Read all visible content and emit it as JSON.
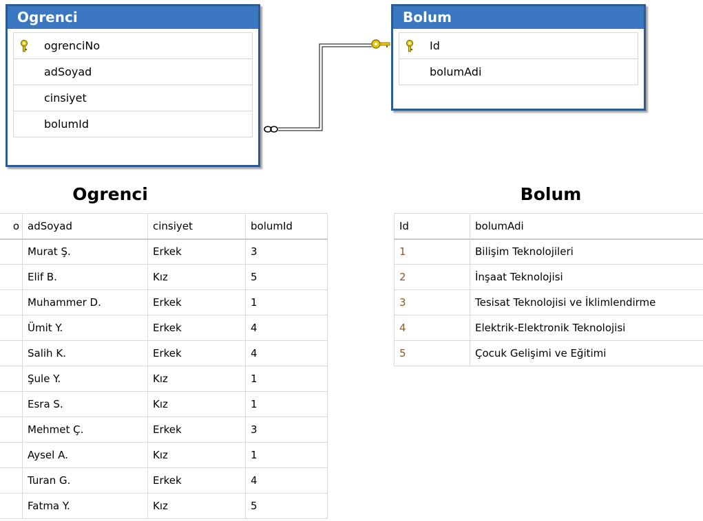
{
  "entities": {
    "ogrenci": {
      "name": "Ogrenci",
      "fields": [
        "ogrenciNo",
        "adSoyad",
        "cinsiyet",
        "bolumId"
      ],
      "key_field": "ogrenciNo"
    },
    "bolum": {
      "name": "Bolum",
      "fields": [
        "Id",
        "bolumAdi"
      ],
      "key_field": "Id"
    }
  },
  "relationship": {
    "from": "Bolum.Id",
    "to": "Ogrenci.bolumId",
    "type": "one-to-many",
    "one_end_icon": "key-icon",
    "many_end_icon": "infinity-icon"
  },
  "ogrenci_table": {
    "title": "Ogrenci",
    "columns": [
      "o",
      "adSoyad",
      "cinsiyet",
      "bolumId"
    ],
    "rows": [
      [
        "Murat Ş.",
        "Erkek",
        "3"
      ],
      [
        "Elif B.",
        "Kız",
        "5"
      ],
      [
        "Muhammer D.",
        "Erkek",
        "1"
      ],
      [
        "Ümit Y.",
        "Erkek",
        "4"
      ],
      [
        "Salih K.",
        "Erkek",
        "4"
      ],
      [
        "Şule Y.",
        "Kız",
        "1"
      ],
      [
        "Esra S.",
        "Kız",
        "1"
      ],
      [
        "Mehmet Ç.",
        "Erkek",
        "3"
      ],
      [
        "Aysel A.",
        "Kız",
        "1"
      ],
      [
        "Turan G.",
        "Erkek",
        "4"
      ],
      [
        "Fatma Y.",
        "Kız",
        "5"
      ]
    ]
  },
  "bolum_table": {
    "title": "Bolum",
    "columns": [
      "Id",
      "bolumAdi"
    ],
    "rows": [
      [
        "1",
        "Bilişim Teknolojileri"
      ],
      [
        "2",
        "İnşaat Teknolojisi"
      ],
      [
        "3",
        "Tesisat Teknolojisi ve İklimlendirme"
      ],
      [
        "4",
        "Elektrik-Elektronik Teknolojisi"
      ],
      [
        "5",
        "Çocuk Gelişimi ve Eğitimi"
      ]
    ]
  },
  "colors": {
    "header_blue": "#3b76c0",
    "border_blue": "#2c5c95",
    "key_gold": "#d4b000"
  }
}
